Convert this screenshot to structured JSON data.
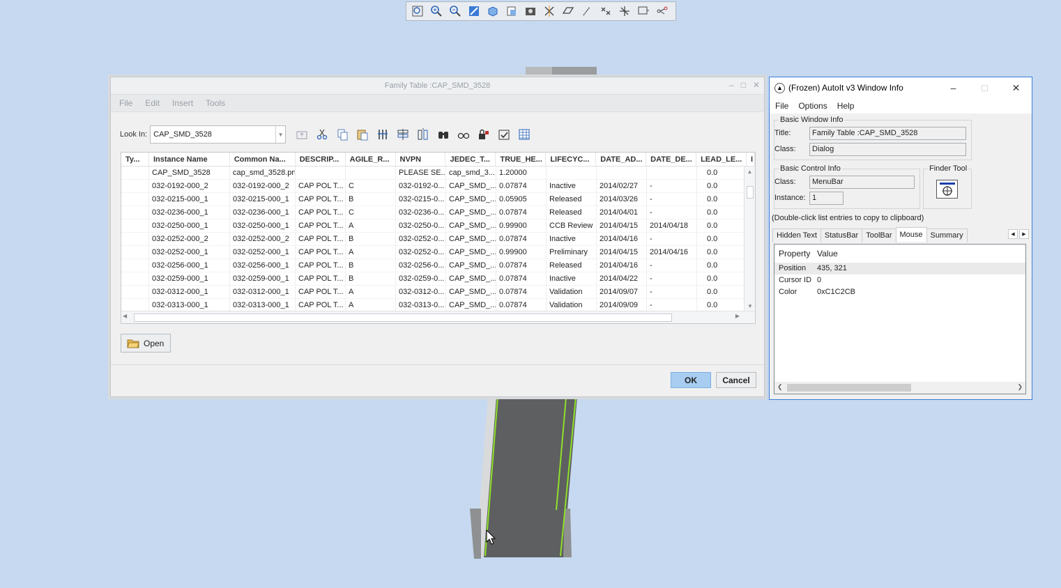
{
  "view_toolbar": {
    "icons": [
      "zoom-window-icon",
      "zoom-in-icon",
      "zoom-out-icon",
      "refit-icon",
      "shading-icon",
      "saved-views-icon",
      "view-manager-icon",
      "datum-display-icon",
      "planes-icon",
      "axes-icon",
      "points-icon",
      "csys-icon",
      "annotation-icon",
      "spin-center-icon"
    ]
  },
  "family_table": {
    "title": "Family Table :CAP_SMD_3528",
    "menu": [
      "File",
      "Edit",
      "Insert",
      "Tools"
    ],
    "look_in_label": "Look In:",
    "look_in_value": "CAP_SMD_3528",
    "columns": [
      "Ty...",
      "Instance Name",
      "Common Na...",
      "DESCRIP...",
      "AGILE_R...",
      "NVPN",
      "JEDEC_T...",
      "TRUE_HE...",
      "LIFECYC...",
      "DATE_AD...",
      "DATE_DE...",
      "LEAD_LE...",
      "I"
    ],
    "rows": [
      [
        "",
        "CAP_SMD_3528",
        "cap_smd_3528.prt",
        "",
        "",
        "PLEASE SE...",
        "cap_smd_3...",
        "1.20000",
        "",
        "",
        "",
        "0.0"
      ],
      [
        "",
        "032-0192-000_2",
        "032-0192-000_2",
        "CAP POL T...",
        "C",
        "032-0192-0...",
        "CAP_SMD_...",
        "0.07874",
        "Inactive",
        "2014/02/27",
        "-",
        "0.0"
      ],
      [
        "",
        "032-0215-000_1",
        "032-0215-000_1",
        "CAP POL T...",
        "B",
        "032-0215-0...",
        "CAP_SMD_...",
        "0.05905",
        "Released",
        "2014/03/26",
        "-",
        "0.0"
      ],
      [
        "",
        "032-0236-000_1",
        "032-0236-000_1",
        "CAP POL T...",
        "C",
        "032-0236-0...",
        "CAP_SMD_...",
        "0.07874",
        "Released",
        "2014/04/01",
        "-",
        "0.0"
      ],
      [
        "",
        "032-0250-000_1",
        "032-0250-000_1",
        "CAP POL T...",
        "A",
        "032-0250-0...",
        "CAP_SMD_...",
        "0.99900",
        "CCB Review",
        "2014/04/15",
        "2014/04/18",
        "0.0"
      ],
      [
        "",
        "032-0252-000_2",
        "032-0252-000_2",
        "CAP POL T...",
        "B",
        "032-0252-0...",
        "CAP_SMD_...",
        "0.07874",
        "Inactive",
        "2014/04/16",
        "-",
        "0.0"
      ],
      [
        "",
        "032-0252-000_1",
        "032-0252-000_1",
        "CAP POL T...",
        "A",
        "032-0252-0...",
        "CAP_SMD_...",
        "0.99900",
        "Preliminary",
        "2014/04/15",
        "2014/04/16",
        "0.0"
      ],
      [
        "",
        "032-0256-000_1",
        "032-0256-000_1",
        "CAP POL T...",
        "B",
        "032-0256-0...",
        "CAP_SMD_...",
        "0.07874",
        "Released",
        "2014/04/16",
        "-",
        "0.0"
      ],
      [
        "",
        "032-0259-000_1",
        "032-0259-000_1",
        "CAP POL T...",
        "B",
        "032-0259-0...",
        "CAP_SMD_...",
        "0.07874",
        "Inactive",
        "2014/04/22",
        "-",
        "0.0"
      ],
      [
        "",
        "032-0312-000_1",
        "032-0312-000_1",
        "CAP POL T...",
        "A",
        "032-0312-0...",
        "CAP_SMD_...",
        "0.07874",
        "Validation",
        "2014/09/07",
        "-",
        "0.0"
      ],
      [
        "",
        "032-0313-000_1",
        "032-0313-000_1",
        "CAP POL T...",
        "A",
        "032-0313-0...",
        "CAP_SMD_...",
        "0.07874",
        "Validation",
        "2014/09/09",
        "-",
        "0.0"
      ]
    ],
    "open_label": "Open",
    "ok_label": "OK",
    "cancel_label": "Cancel"
  },
  "autoit": {
    "title": "(Frozen) AutoIt v3 Window Info",
    "menu": [
      "File",
      "Options",
      "Help"
    ],
    "basic_window_info": {
      "legend": "Basic Window Info",
      "title_label": "Title:",
      "title_value": "Family Table :CAP_SMD_3528",
      "class_label": "Class:",
      "class_value": "Dialog"
    },
    "basic_control_info": {
      "legend": "Basic Control Info",
      "class_label": "Class:",
      "class_value": "MenuBar",
      "instance_label": "Instance:",
      "instance_value": "1"
    },
    "finder_tool_legend": "Finder Tool",
    "hint": "(Double-click list entries to copy to clipboard)",
    "tabs": [
      "Hidden Text",
      "StatusBar",
      "ToolBar",
      "Mouse",
      "Summary"
    ],
    "active_tab": "Mouse",
    "list_headers": [
      "Property",
      "Value"
    ],
    "list_rows": [
      [
        "Position",
        "435, 321"
      ],
      [
        "Cursor ID",
        "0"
      ],
      [
        "Color",
        "0xC1C2CB"
      ]
    ]
  }
}
